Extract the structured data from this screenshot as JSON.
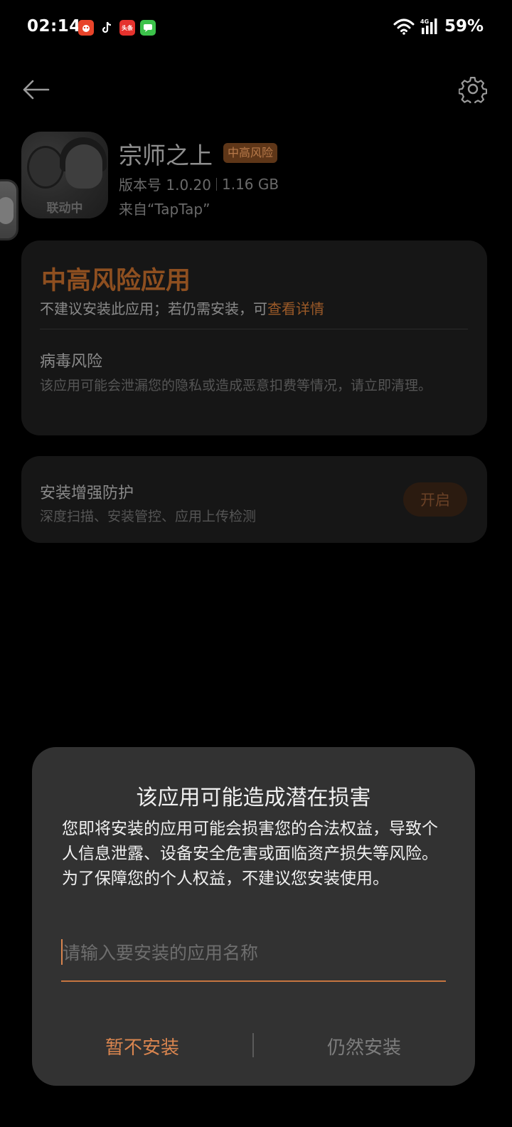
{
  "status_bar": {
    "time": "02:14",
    "notification_icons": [
      {
        "icon": "taobao-app-icon",
        "color": "#e8442a",
        "label": ""
      },
      {
        "icon": "tiktok-app-icon",
        "color": "#000000",
        "label": ""
      },
      {
        "icon": "toutiao-app-icon",
        "color": "#e5322d",
        "label": "头条"
      },
      {
        "icon": "message-app-icon",
        "color": "#3cc24a",
        "label": ""
      }
    ],
    "network": "4G",
    "battery": "59%"
  },
  "header": {
    "back_icon": "arrow-left-icon",
    "settings_icon": "gear-icon"
  },
  "app": {
    "icon_label": "联动中",
    "name": "宗师之上",
    "risk_badge": "中高风险",
    "version": "版本号 1.0.20",
    "size": "1.16 GB",
    "source": "来自“TapTap”"
  },
  "risk_card": {
    "title": "中高风险应用",
    "desc_prefix": "不建议安装此应用；若仍需安装，可",
    "detail_link": "查看详情",
    "virus_title": "病毒风险",
    "virus_desc": "该应用可能会泄漏您的隐私或造成恶意扣费等情况，请立即清理。"
  },
  "protect_card": {
    "title": "安装增强防护",
    "desc": "深度扫描、安装管控、应用上传检测",
    "button_label": "开启"
  },
  "dialog": {
    "title": "该应用可能造成潜在损害",
    "body_line1": "您即将安装的应用可能会损害您的合法权益，导致个人信息泄露、设备安全危害或面临资产损失等风险。",
    "body_line2": "为了保障您的个人权益，不建议您安装使用。",
    "input_placeholder": "请输入要安装的应用名称",
    "input_value": "",
    "cancel_label": "暂不安装",
    "install_label": "仍然安装"
  },
  "colors": {
    "accent": "#d9854f",
    "risk_orange_dim": "#8e4f20",
    "dialog_bg": "#323232",
    "card_bg": "#161616"
  }
}
